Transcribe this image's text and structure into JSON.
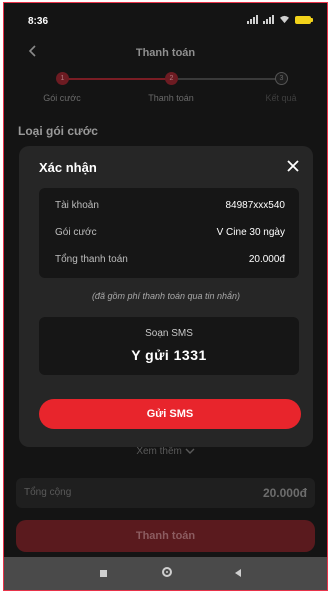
{
  "status_bar": {
    "time": "8:36"
  },
  "header": {
    "title": "Thanh toán"
  },
  "stepper": {
    "steps": [
      {
        "number": "1",
        "label": "Gói cước"
      },
      {
        "number": "2",
        "label": "Thanh toán"
      },
      {
        "number": "3",
        "label": "Kết quả"
      }
    ]
  },
  "section": {
    "title": "Loại gói cước"
  },
  "modal": {
    "title": "Xác nhận",
    "rows": [
      {
        "key": "Tài khoản",
        "value": "84987xxx540"
      },
      {
        "key": "Gói cước",
        "value": "V Cine 30 ngày"
      },
      {
        "key": "Tổng thanh toán",
        "value": "20.000đ"
      }
    ],
    "note": "(đã gồm phí thanh toán qua tin nhắn)",
    "sms_label": "Soạn SMS",
    "sms_code": "Y gửi 1331",
    "send_button": "Gửi SMS"
  },
  "footer": {
    "more": "Xem thêm",
    "total_label": "Tổng cộng",
    "total_value": "20.000đ",
    "pay_button": "Thanh toán"
  },
  "colors": {
    "accent": "#e8252c",
    "background": "#141414",
    "modal": "#262626"
  }
}
